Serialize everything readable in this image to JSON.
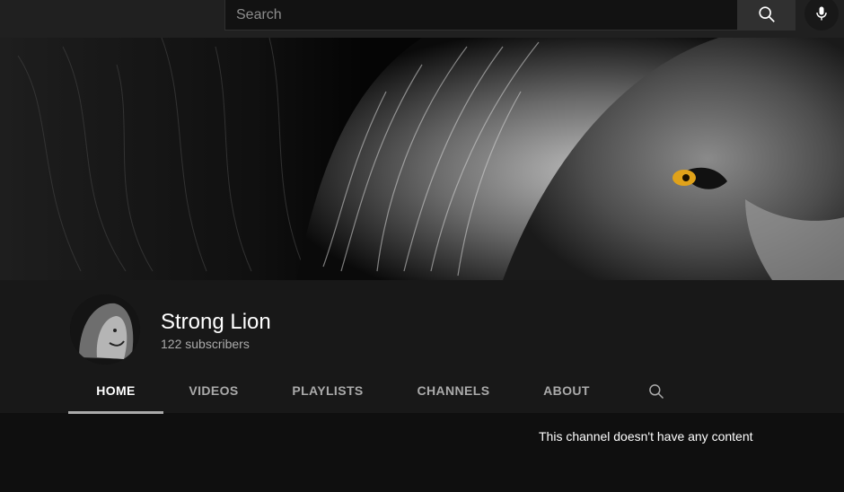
{
  "search": {
    "placeholder": "Search"
  },
  "channel": {
    "name": "Strong Lion",
    "subscribers": "122 subscribers"
  },
  "tabs": [
    {
      "label": "HOME",
      "active": true
    },
    {
      "label": "VIDEOS"
    },
    {
      "label": "PLAYLISTS"
    },
    {
      "label": "CHANNELS"
    },
    {
      "label": "ABOUT"
    }
  ],
  "content": {
    "empty_message": "This channel doesn't have any content"
  },
  "icons": {
    "search_button": "search-icon",
    "voice_search": "mic-icon",
    "tab_search": "search-icon"
  },
  "colors": {
    "page_bg": "#0f0f0f",
    "header_bg": "#181818",
    "accent_eye": "#e0a21a"
  }
}
